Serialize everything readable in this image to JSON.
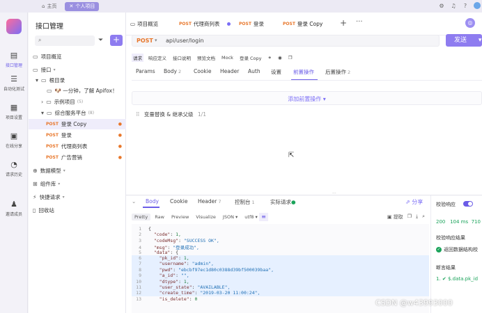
{
  "topbar": {
    "home_tab": "主页",
    "project_tab": "个人项目"
  },
  "rail": [
    {
      "label": "接口管理",
      "icon": "api-icon"
    },
    {
      "label": "自动化测试",
      "icon": "automation-icon"
    },
    {
      "label": "项目设置",
      "icon": "settings-icon"
    },
    {
      "label": "在线分享",
      "icon": "share-icon"
    },
    {
      "label": "请求历史",
      "icon": "history-icon"
    },
    {
      "label": "邀请成员",
      "icon": "invite-icon"
    }
  ],
  "sidebar": {
    "title": "接口管理",
    "items": {
      "overview": "项目概览",
      "api": "接口",
      "root": "根目录",
      "apifox": "🐶 一分钟，了解 Apifox！",
      "example": "示例项目",
      "example_count": "(5)",
      "composite": "综合服务平台",
      "composite_count": "(8)",
      "login_copy": "登录 Copy",
      "login": "登录",
      "agent_list": "代理商列表",
      "ads": "广告营销",
      "models": "数据模型",
      "components": "组件库",
      "quick": "快捷请求",
      "trash": "回收站"
    },
    "method": "POST"
  },
  "doc_tabs": {
    "overview": "项目概览",
    "agent_list": "代理商列表",
    "login": "登录",
    "login_copy": "登录 Copy",
    "method": "POST"
  },
  "request": {
    "method": "POST",
    "url": "api/user/login",
    "send": "发送"
  },
  "toolbar2": [
    "请求",
    "响应定义",
    "接口说明",
    "预览文档",
    "Mock",
    "登录 Copy"
  ],
  "req_tabs": {
    "params": "Params",
    "body": "Body",
    "body_count": "2",
    "cookie": "Cookie",
    "header": "Header",
    "auth": "Auth",
    "settings": "设置",
    "pre": "前置操作",
    "post": "后置操作",
    "post_count": "2"
  },
  "preops": {
    "add": "添加前置操作",
    "var_row": "变量替换 & 继承父级",
    "var_count": "1/1"
  },
  "response": {
    "tabs": {
      "body": "Body",
      "cookie": "Cookie",
      "header": "Header",
      "header_count": "7",
      "console": "控制台",
      "console_count": "1",
      "actual": "实际请求"
    },
    "share": "分享",
    "formats": [
      "Pretty",
      "Raw",
      "Preview",
      "Visualize"
    ],
    "format_select": "JSON",
    "charset": "utf8",
    "extract": "提取",
    "code": [
      {
        "n": "1",
        "t": "{"
      },
      {
        "n": "2",
        "k": "\"code\"",
        "v": "1",
        "vt": "num",
        "c": ","
      },
      {
        "n": "3",
        "k": "\"codeMsg\"",
        "v": "\"SUCCESS OK\"",
        "vt": "s",
        "c": ","
      },
      {
        "n": "4",
        "k": "\"msg\"",
        "v": "\"登录成功\"",
        "vt": "s",
        "c": ","
      },
      {
        "n": "5",
        "k": "\"data\"",
        "v": "{",
        "vt": "",
        "c": ""
      },
      {
        "n": "6",
        "k": "\"pk_id\"",
        "v": "1",
        "vt": "num",
        "c": ",",
        "indent": true
      },
      {
        "n": "7",
        "k": "\"username\"",
        "v": "\"admin\"",
        "vt": "s",
        "c": ",",
        "indent": true
      },
      {
        "n": "8",
        "k": "\"pwd\"",
        "v": "\"ebcbf97ec1d80c0388d39bf500039baa\"",
        "vt": "s",
        "c": ",",
        "indent": true
      },
      {
        "n": "9",
        "k": "\"a_id\"",
        "v": "\"\"",
        "vt": "s",
        "c": ",",
        "indent": true
      },
      {
        "n": "10",
        "k": "\"dtype\"",
        "v": "1",
        "vt": "num",
        "c": ",",
        "indent": true
      },
      {
        "n": "11",
        "k": "\"user_state\"",
        "v": "\"AVAILABLE\"",
        "vt": "s",
        "c": ",",
        "indent": true
      },
      {
        "n": "12",
        "k": "\"create_time\"",
        "v": "\"2019-03-20 11:00:24\"",
        "vt": "s",
        "c": ",",
        "indent": true
      },
      {
        "n": "13",
        "k": "\"is_delete\"",
        "v": "0",
        "vt": "num",
        "c": "",
        "indent": true
      }
    ]
  },
  "right_panel": {
    "validate": "校验响应",
    "status": "200",
    "time": "104 ms",
    "size": "710",
    "valid_result": "校验响应结果",
    "valid_ok": "返回数据结构校",
    "assert": "断言结果",
    "assert_item": "1. ✔ $.data.pk_id"
  },
  "watermark": "CSDN @w43993000"
}
